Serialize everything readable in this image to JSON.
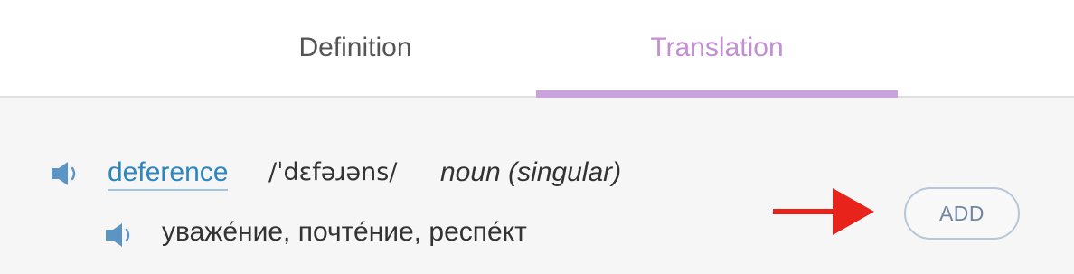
{
  "tabs": {
    "definition_label": "Definition",
    "translation_label": "Translation",
    "active": "Translation"
  },
  "entry": {
    "word": "deference",
    "pronunciation": "/ˈdɛfəɹəns/",
    "part_of_speech": "noun (singular)",
    "translation": "уваже́ние, почте́ние, респе́кт"
  },
  "actions": {
    "add_label": "ADD"
  },
  "icons": {
    "word_audio": "speaker-icon",
    "translation_audio": "speaker-icon",
    "annotation": "red-arrow-icon"
  },
  "colors": {
    "active_tab": "#c38fd0",
    "tab_indicator": "#c9a3dc",
    "link": "#2e86c1",
    "speaker": "#5b95c4",
    "arrow": "#e8231c"
  }
}
